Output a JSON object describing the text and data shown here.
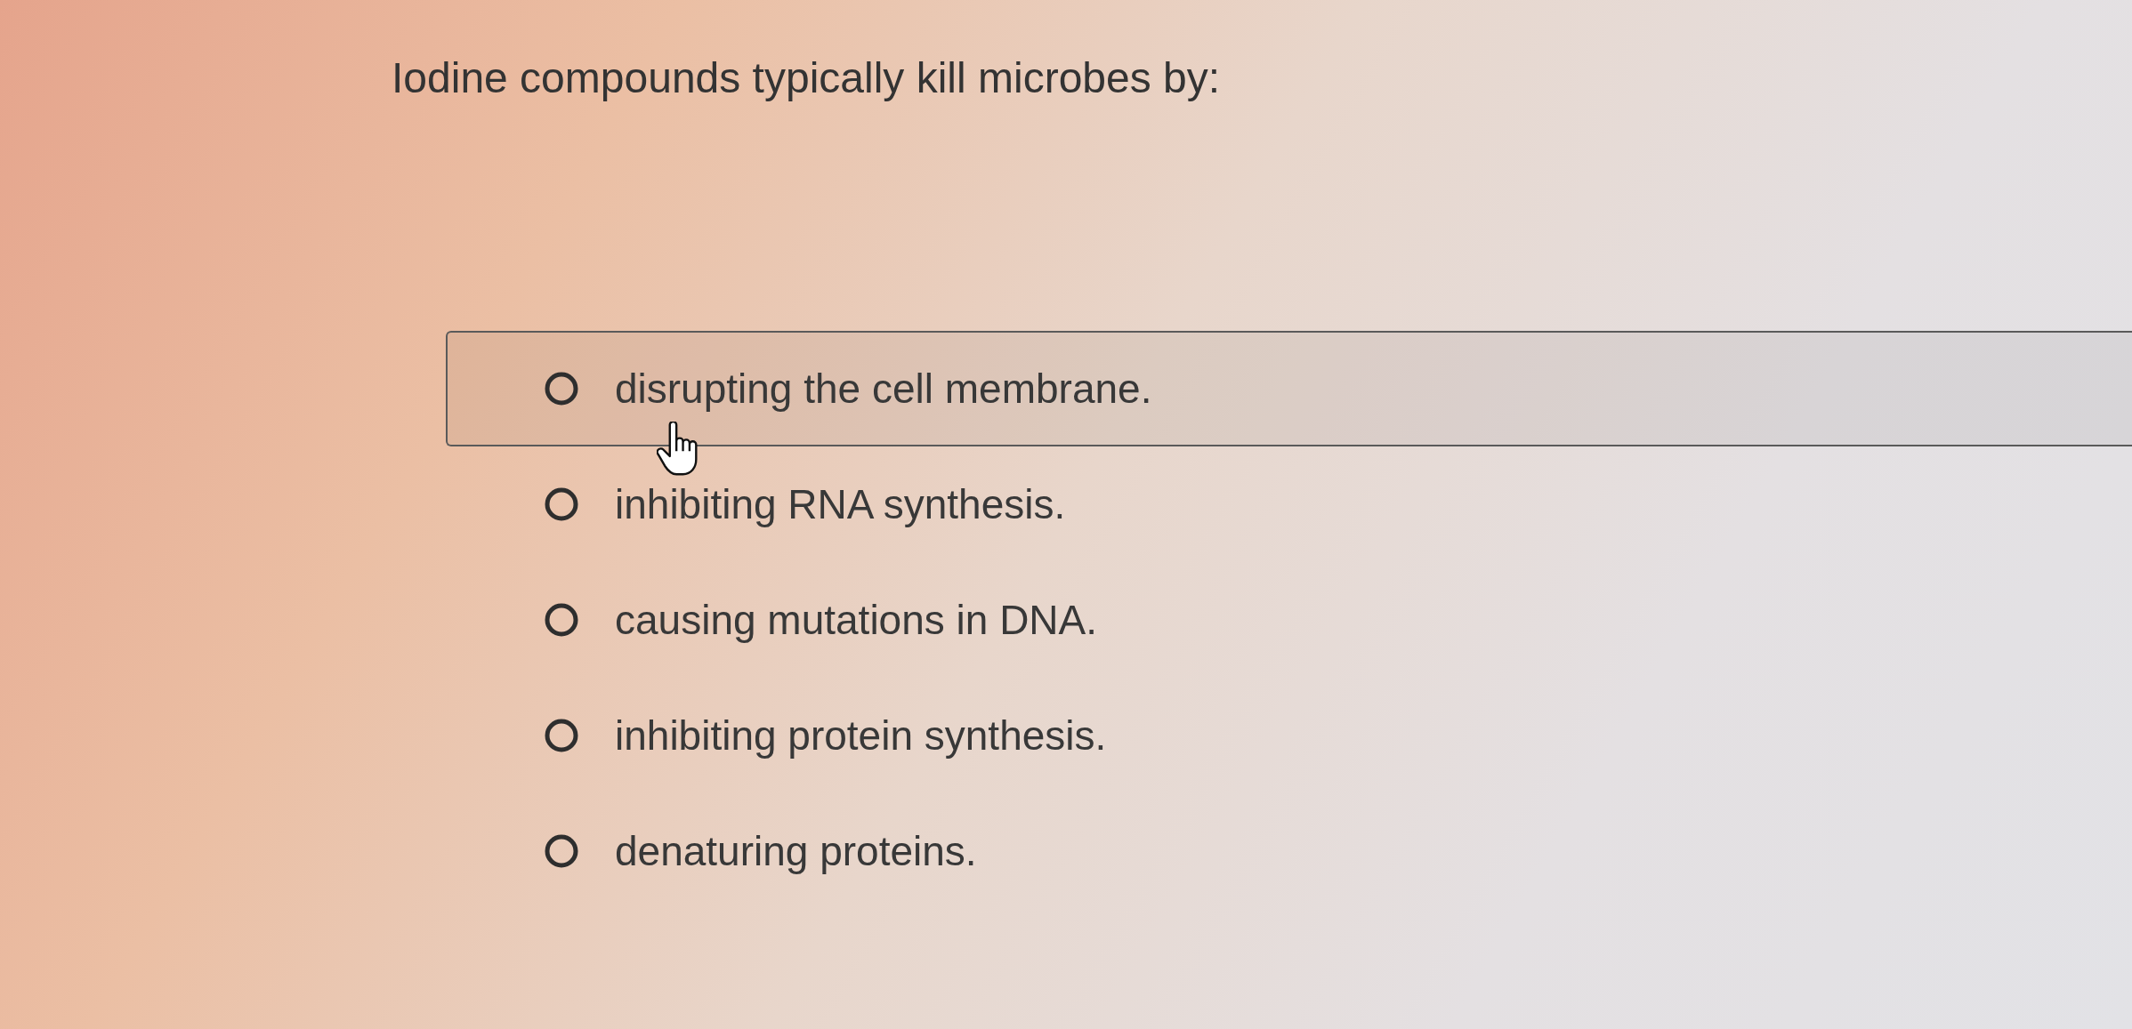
{
  "question": {
    "text": "Iodine compounds typically kill microbes by:"
  },
  "options": [
    {
      "label": "disrupting the cell membrane.",
      "selected": false,
      "hovered": true
    },
    {
      "label": "inhibiting RNA synthesis.",
      "selected": false,
      "hovered": false
    },
    {
      "label": "causing mutations in DNA.",
      "selected": false,
      "hovered": false
    },
    {
      "label": "inhibiting protein synthesis.",
      "selected": false,
      "hovered": false
    },
    {
      "label": "denaturing proteins.",
      "selected": false,
      "hovered": false
    }
  ]
}
